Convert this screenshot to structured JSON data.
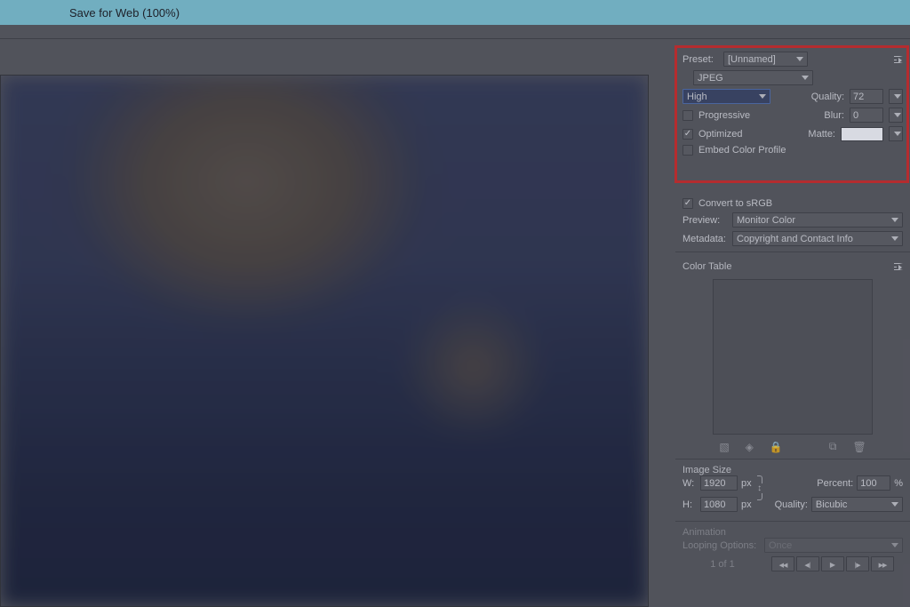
{
  "window": {
    "title": "Save for Web (100%)"
  },
  "preset": {
    "label": "Preset:",
    "value": "[Unnamed]",
    "format": "JPEG",
    "quality_preset": "High",
    "quality_label": "Quality:",
    "quality_value": "72",
    "progressive_label": "Progressive",
    "progressive_checked": false,
    "optimized_label": "Optimized",
    "optimized_checked": true,
    "embed_profile_label": "Embed Color Profile",
    "embed_profile_checked": false,
    "blur_label": "Blur:",
    "blur_value": "0",
    "matte_label": "Matte:",
    "matte_color": "#ffffff"
  },
  "color": {
    "convert_srgb_label": "Convert to sRGB",
    "convert_srgb_checked": true,
    "preview_label": "Preview:",
    "preview_value": "Monitor Color",
    "metadata_label": "Metadata:",
    "metadata_value": "Copyright and Contact Info"
  },
  "colortable": {
    "title": "Color Table"
  },
  "image_size": {
    "title": "Image Size",
    "w_label": "W:",
    "w_value": "1920",
    "h_label": "H:",
    "h_value": "1080",
    "px": "px",
    "percent_label": "Percent:",
    "percent_value": "100",
    "percent_unit": "%",
    "quality_label": "Quality:",
    "quality_value": "Bicubic"
  },
  "animation": {
    "title": "Animation",
    "looping_label": "Looping Options:",
    "looping_value": "Once",
    "frame_text": "1 of 1"
  }
}
